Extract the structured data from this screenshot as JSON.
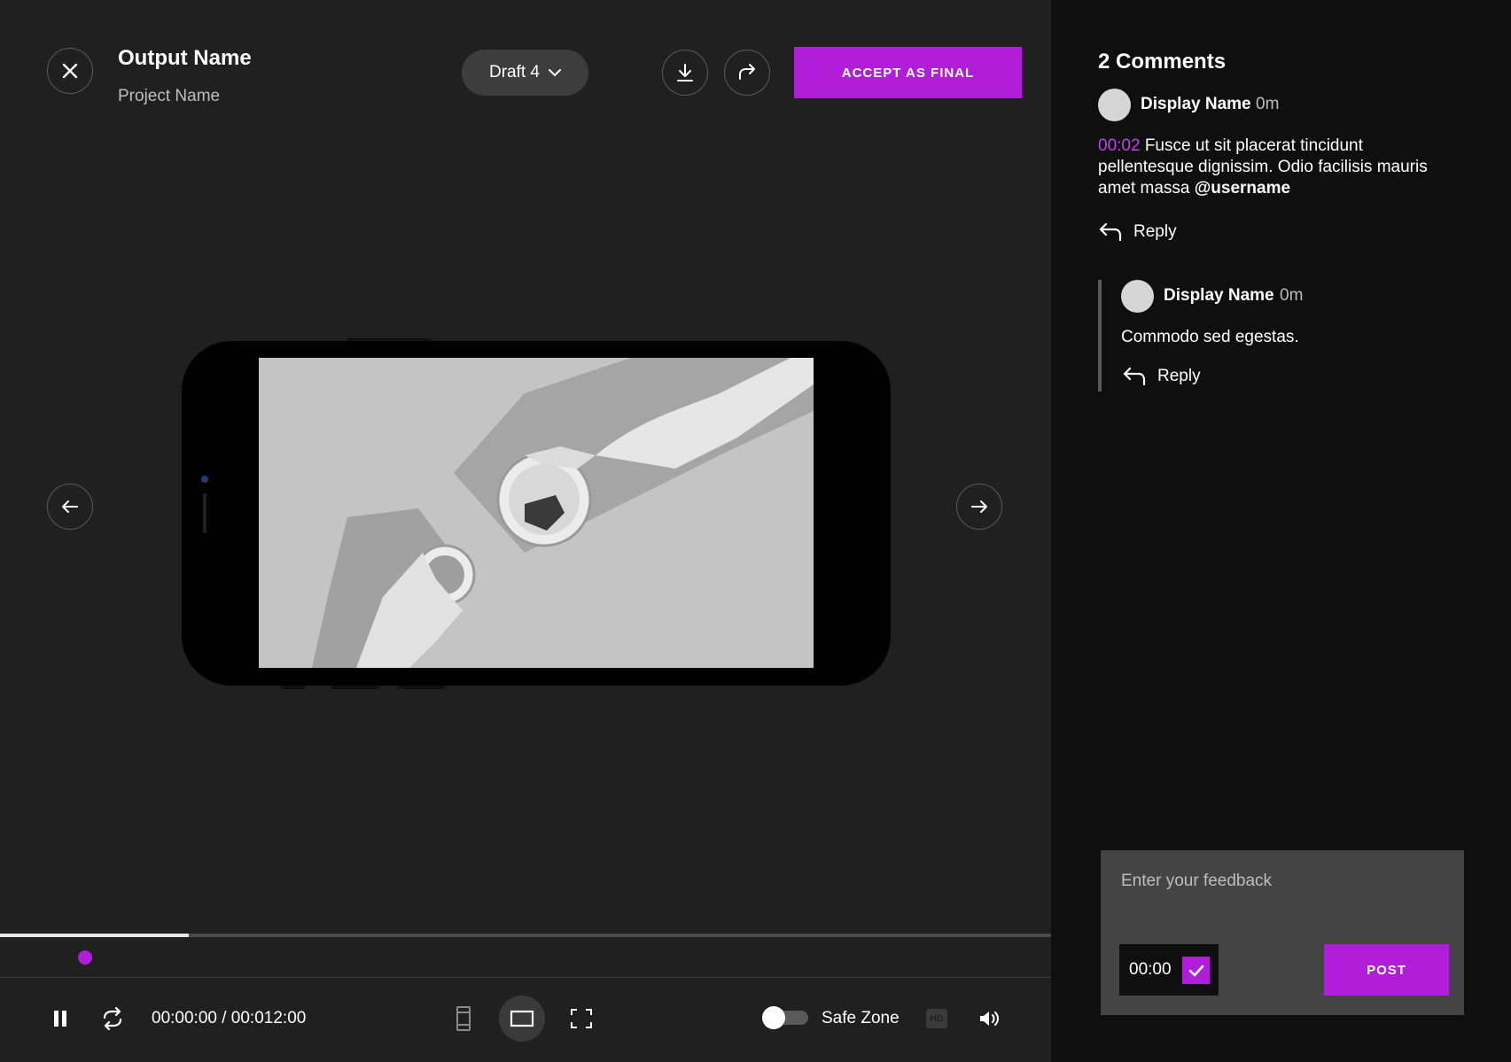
{
  "header": {
    "output_name": "Output Name",
    "project_name": "Project Name",
    "draft_label": "Draft 4",
    "accept_label": "ACCEPT AS FINAL"
  },
  "player": {
    "time_display": "00:00:00 / 00:012:00",
    "progress_fraction": 0.18,
    "safe_zone_label": "Safe Zone",
    "safe_zone_on": false,
    "hd_label": "HD"
  },
  "comments": {
    "title": "2 Comments",
    "items": [
      {
        "display_name": "Display Name",
        "time": "0m",
        "timestamp": "00:02",
        "text": " Fusce ut sit placerat tincidunt pellentesque dignissim. Odio facilisis mauris amet massa ",
        "mention": "@username",
        "reply_label": "Reply"
      },
      {
        "display_name": "Display Name",
        "time": "0m",
        "text": "Commodo sed egestas.",
        "reply_label": "Reply"
      }
    ]
  },
  "feedback": {
    "placeholder": "Enter your feedback",
    "timestamp": "00:00",
    "post_label": "POST"
  },
  "colors": {
    "accent": "#b01ed9",
    "background": "#202020",
    "sidebar": "#0f0f0f"
  }
}
